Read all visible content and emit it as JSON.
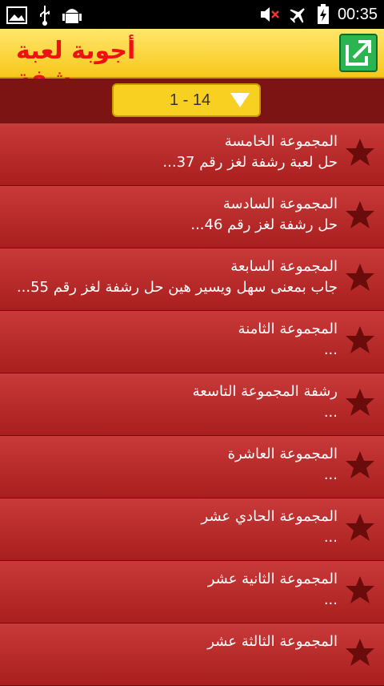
{
  "status": {
    "time": "00:35",
    "left_icons": [
      "image-icon",
      "usb-icon",
      "android-debug-icon"
    ],
    "right_icons": [
      "mute-icon",
      "airplane-icon",
      "battery-charging-icon"
    ]
  },
  "app": {
    "title": "أجوبة لعبة رشفة",
    "share_icon": "share-icon"
  },
  "filter": {
    "selected": "1 - 14"
  },
  "rows": [
    {
      "title": "المجموعة الخامسة",
      "subtitle": "حل لعبة رشفة لغز رقم 37..."
    },
    {
      "title": "المجموعة السادسة",
      "subtitle": "حل رشفة لغز رقم 46..."
    },
    {
      "title": "المجموعة السابعة",
      "subtitle": "جاب   بمعنى سهل ويسير هين    حل رشفة لغز رقم 55..."
    },
    {
      "title": "المجموعة الثامنة",
      "subtitle": "..."
    },
    {
      "title": "رشفة المجموعة التاسعة",
      "subtitle": "..."
    },
    {
      "title": "المجموعة العاشرة",
      "subtitle": "..."
    },
    {
      "title": "المجموعة الحادي عشر",
      "subtitle": "..."
    },
    {
      "title": "المجموعة الثانية عشر",
      "subtitle": "..."
    },
    {
      "title": "المجموعة الثالثة عشر",
      "subtitle": ""
    }
  ],
  "colors": {
    "appbar": "#f7c81b",
    "title": "#e11111",
    "row": "#b82828",
    "star": "#6a0c0c"
  }
}
